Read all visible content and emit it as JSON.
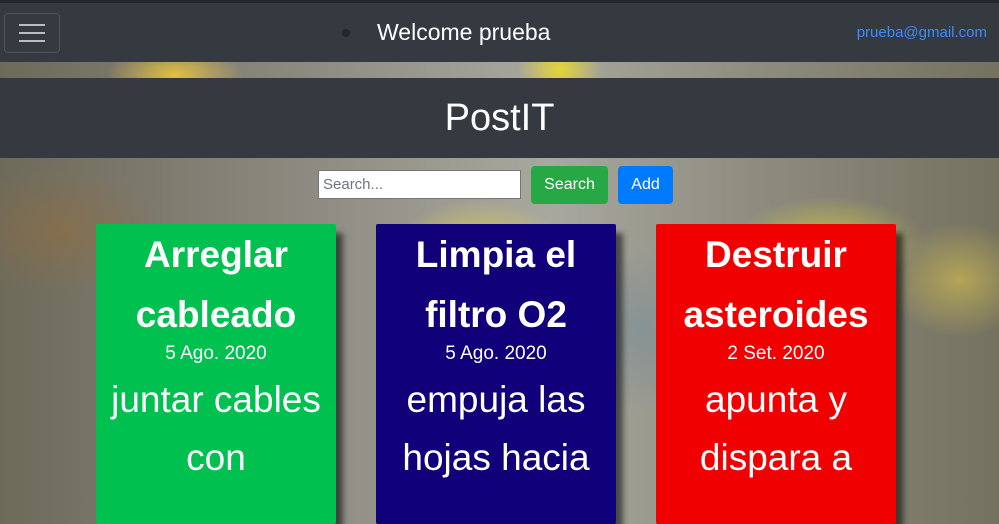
{
  "navbar": {
    "menu_icon": "hamburger-menu-icon",
    "welcome": "Welcome prueba",
    "email": "prueba@gmail.com"
  },
  "brand": {
    "title": "PostIT"
  },
  "search": {
    "placeholder": "Search...",
    "value": "",
    "search_label": "Search",
    "add_label": "Add"
  },
  "colors": {
    "navbar": "#343a40",
    "search_button": "#28a745",
    "add_button": "#007bff",
    "link": "#3d8bfd"
  },
  "notes": [
    {
      "title": "Arreglar cableado",
      "date": "5 Ago. 2020",
      "body": "juntar cables con",
      "color": "#00c050"
    },
    {
      "title": "Limpia el filtro O2",
      "date": "5 Ago. 2020",
      "body": "empuja las hojas hacia",
      "color": "#10007a"
    },
    {
      "title": "Destruir asteroides",
      "date": "2 Set. 2020",
      "body": "apunta y dispara a",
      "color": "#f00000"
    }
  ]
}
